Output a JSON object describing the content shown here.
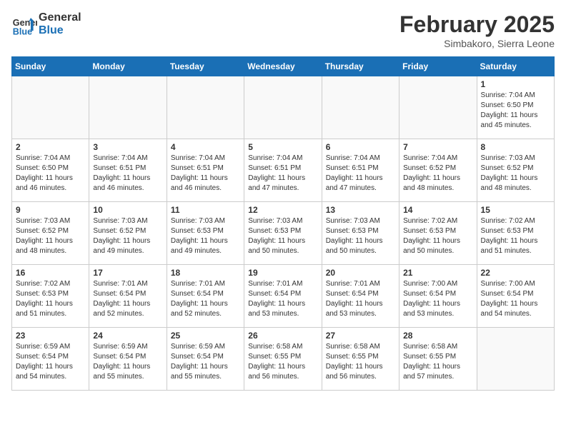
{
  "header": {
    "logo_line1": "General",
    "logo_line2": "Blue",
    "month": "February 2025",
    "location": "Simbakoro, Sierra Leone"
  },
  "weekdays": [
    "Sunday",
    "Monday",
    "Tuesday",
    "Wednesday",
    "Thursday",
    "Friday",
    "Saturday"
  ],
  "weeks": [
    [
      {
        "day": "",
        "info": ""
      },
      {
        "day": "",
        "info": ""
      },
      {
        "day": "",
        "info": ""
      },
      {
        "day": "",
        "info": ""
      },
      {
        "day": "",
        "info": ""
      },
      {
        "day": "",
        "info": ""
      },
      {
        "day": "1",
        "info": "Sunrise: 7:04 AM\nSunset: 6:50 PM\nDaylight: 11 hours and 45 minutes."
      }
    ],
    [
      {
        "day": "2",
        "info": "Sunrise: 7:04 AM\nSunset: 6:50 PM\nDaylight: 11 hours and 46 minutes."
      },
      {
        "day": "3",
        "info": "Sunrise: 7:04 AM\nSunset: 6:51 PM\nDaylight: 11 hours and 46 minutes."
      },
      {
        "day": "4",
        "info": "Sunrise: 7:04 AM\nSunset: 6:51 PM\nDaylight: 11 hours and 46 minutes."
      },
      {
        "day": "5",
        "info": "Sunrise: 7:04 AM\nSunset: 6:51 PM\nDaylight: 11 hours and 47 minutes."
      },
      {
        "day": "6",
        "info": "Sunrise: 7:04 AM\nSunset: 6:51 PM\nDaylight: 11 hours and 47 minutes."
      },
      {
        "day": "7",
        "info": "Sunrise: 7:04 AM\nSunset: 6:52 PM\nDaylight: 11 hours and 48 minutes."
      },
      {
        "day": "8",
        "info": "Sunrise: 7:03 AM\nSunset: 6:52 PM\nDaylight: 11 hours and 48 minutes."
      }
    ],
    [
      {
        "day": "9",
        "info": "Sunrise: 7:03 AM\nSunset: 6:52 PM\nDaylight: 11 hours and 48 minutes."
      },
      {
        "day": "10",
        "info": "Sunrise: 7:03 AM\nSunset: 6:52 PM\nDaylight: 11 hours and 49 minutes."
      },
      {
        "day": "11",
        "info": "Sunrise: 7:03 AM\nSunset: 6:53 PM\nDaylight: 11 hours and 49 minutes."
      },
      {
        "day": "12",
        "info": "Sunrise: 7:03 AM\nSunset: 6:53 PM\nDaylight: 11 hours and 50 minutes."
      },
      {
        "day": "13",
        "info": "Sunrise: 7:03 AM\nSunset: 6:53 PM\nDaylight: 11 hours and 50 minutes."
      },
      {
        "day": "14",
        "info": "Sunrise: 7:02 AM\nSunset: 6:53 PM\nDaylight: 11 hours and 50 minutes."
      },
      {
        "day": "15",
        "info": "Sunrise: 7:02 AM\nSunset: 6:53 PM\nDaylight: 11 hours and 51 minutes."
      }
    ],
    [
      {
        "day": "16",
        "info": "Sunrise: 7:02 AM\nSunset: 6:53 PM\nDaylight: 11 hours and 51 minutes."
      },
      {
        "day": "17",
        "info": "Sunrise: 7:01 AM\nSunset: 6:54 PM\nDaylight: 11 hours and 52 minutes."
      },
      {
        "day": "18",
        "info": "Sunrise: 7:01 AM\nSunset: 6:54 PM\nDaylight: 11 hours and 52 minutes."
      },
      {
        "day": "19",
        "info": "Sunrise: 7:01 AM\nSunset: 6:54 PM\nDaylight: 11 hours and 53 minutes."
      },
      {
        "day": "20",
        "info": "Sunrise: 7:01 AM\nSunset: 6:54 PM\nDaylight: 11 hours and 53 minutes."
      },
      {
        "day": "21",
        "info": "Sunrise: 7:00 AM\nSunset: 6:54 PM\nDaylight: 11 hours and 53 minutes."
      },
      {
        "day": "22",
        "info": "Sunrise: 7:00 AM\nSunset: 6:54 PM\nDaylight: 11 hours and 54 minutes."
      }
    ],
    [
      {
        "day": "23",
        "info": "Sunrise: 6:59 AM\nSunset: 6:54 PM\nDaylight: 11 hours and 54 minutes."
      },
      {
        "day": "24",
        "info": "Sunrise: 6:59 AM\nSunset: 6:54 PM\nDaylight: 11 hours and 55 minutes."
      },
      {
        "day": "25",
        "info": "Sunrise: 6:59 AM\nSunset: 6:54 PM\nDaylight: 11 hours and 55 minutes."
      },
      {
        "day": "26",
        "info": "Sunrise: 6:58 AM\nSunset: 6:55 PM\nDaylight: 11 hours and 56 minutes."
      },
      {
        "day": "27",
        "info": "Sunrise: 6:58 AM\nSunset: 6:55 PM\nDaylight: 11 hours and 56 minutes."
      },
      {
        "day": "28",
        "info": "Sunrise: 6:58 AM\nSunset: 6:55 PM\nDaylight: 11 hours and 57 minutes."
      },
      {
        "day": "",
        "info": ""
      }
    ]
  ]
}
